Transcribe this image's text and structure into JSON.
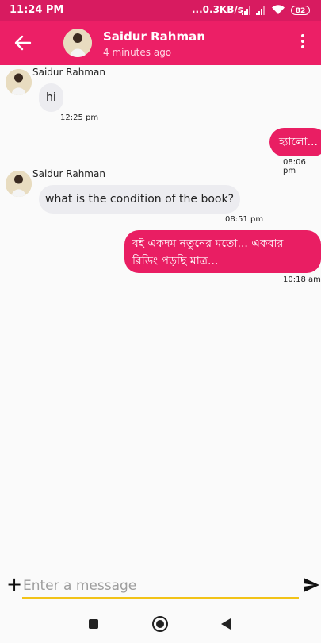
{
  "status_bar": {
    "time": "11:24 PM",
    "network_speed": "...0.3KB/s",
    "battery": "82"
  },
  "header": {
    "back_icon": "arrow-left-icon",
    "contact_name": "Saidur Rahman",
    "last_seen": "4 minutes ago",
    "menu_icon": "more-vert-icon"
  },
  "messages": [
    {
      "direction": "incoming",
      "sender": "Saidur Rahman",
      "text": "hi",
      "time": "12:25 pm"
    },
    {
      "direction": "outgoing",
      "text": "হ্যালো...",
      "time": "08:06 pm"
    },
    {
      "direction": "incoming",
      "sender": "Saidur Rahman",
      "text": "what is the condition of the book?",
      "time": "08:51 pm"
    },
    {
      "direction": "outgoing",
      "text_line1": "বই একদম নতুনের মতো... একবার",
      "text_line2": "রিডিং পড়ছি মাত্র...",
      "time": "10:18 am"
    }
  ],
  "composer": {
    "plus_label": "+",
    "placeholder": "Enter a message",
    "value": "",
    "send_icon": "send-icon"
  },
  "colors": {
    "status_bar": "#d81b60",
    "app_bar": "#ec1f66",
    "outgoing_bubble": "#e91e63",
    "incoming_bubble": "#ececf0",
    "input_underline": "#f2c318"
  }
}
